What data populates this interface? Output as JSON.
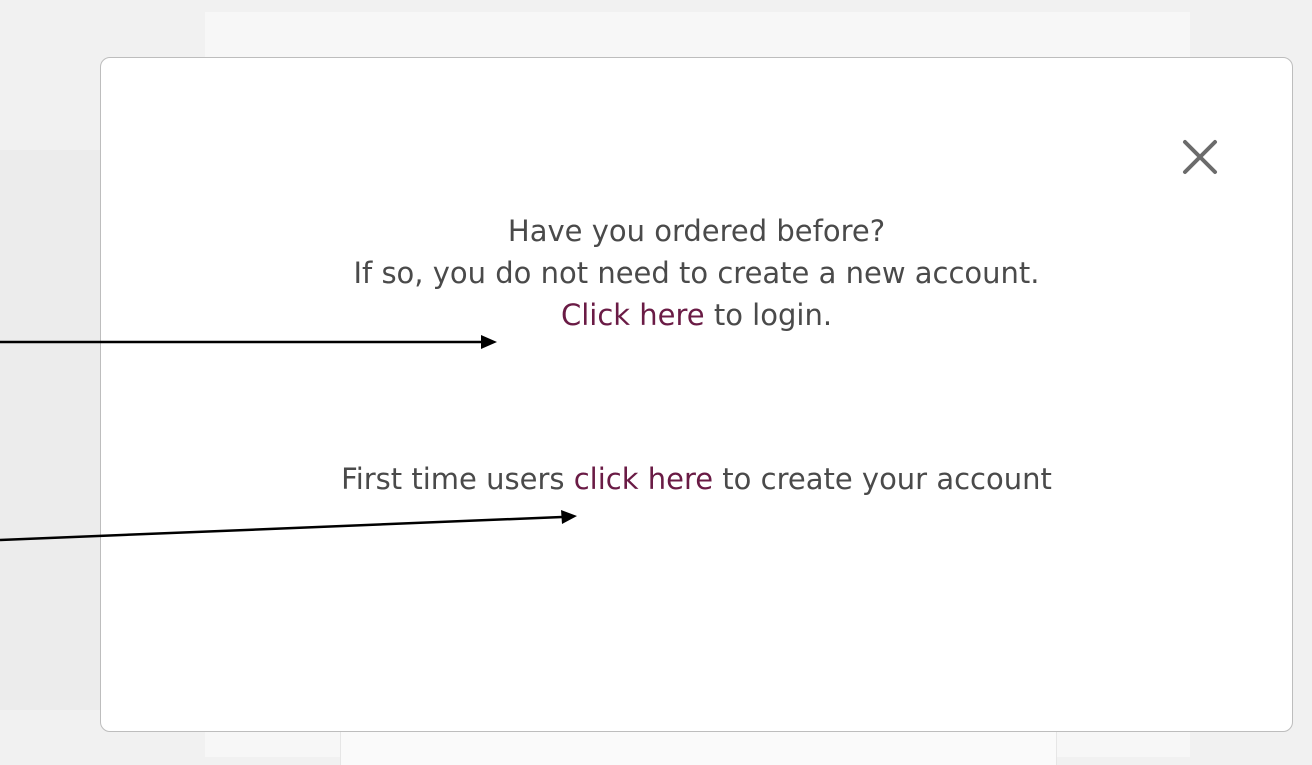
{
  "modal": {
    "line1": "Have you ordered before?",
    "line2": "If so, you do not need to create a new account.",
    "login_link": "Click here",
    "login_suffix": " to login.",
    "first_time_prefix": "First time users ",
    "create_link": "click here",
    "create_suffix": " to create your account"
  },
  "icons": {
    "close": "close-icon",
    "arrows": "arrow-annotation"
  },
  "colors": {
    "link": "#6a1b45",
    "text": "#4a4a4a",
    "border": "#bdbdbd",
    "backdrop": "#f1f1f1"
  }
}
